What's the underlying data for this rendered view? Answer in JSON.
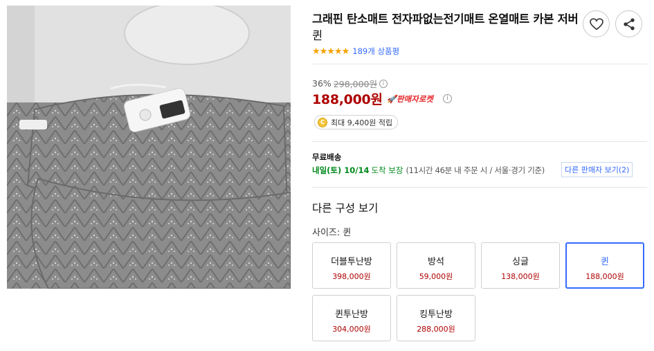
{
  "product": {
    "title": "그래핀 탄소매트 전자파없는전기매트 온열매트 카본 저버",
    "selected_option": "퀸",
    "image_alt": "gray quilted electric mat with controller"
  },
  "rating": {
    "stars": "★★★★★",
    "review_count_text": "189개 상품평"
  },
  "price": {
    "discount_rate": "36%",
    "original_price": "298,000원",
    "sale_price": "188,000원",
    "rocket_label": "판매자로켓",
    "cash_reward": "최대 9,400원 적립",
    "info_glyph": "i",
    "coin_glyph": "C"
  },
  "shipping": {
    "label": "무료배송",
    "date": "내일(토) 10/14",
    "arrival": "도착 보장",
    "detail": "(11시간 46분  내 주문 시 / 서울·경기 기준)",
    "other_seller": "다른 판매자 보기(2)"
  },
  "options": {
    "section_title": "다른 구성 보기",
    "size_label": "사이즈: 퀸",
    "items": [
      {
        "name": "더블투난방",
        "price": "398,000원"
      },
      {
        "name": "방석",
        "price": "59,000원"
      },
      {
        "name": "싱글",
        "price": "138,000원"
      },
      {
        "name": "퀸",
        "price": "188,000원"
      },
      {
        "name": "퀸투난방",
        "price": "304,000원"
      },
      {
        "name": "킹투난방",
        "price": "288,000원"
      }
    ]
  },
  "icons": {
    "wishlist": "heart-icon",
    "share": "share-icon"
  },
  "colors": {
    "accent": "#346aff",
    "price_red": "#ae0000",
    "star": "#f5a300",
    "delivery_green": "#00891a"
  }
}
